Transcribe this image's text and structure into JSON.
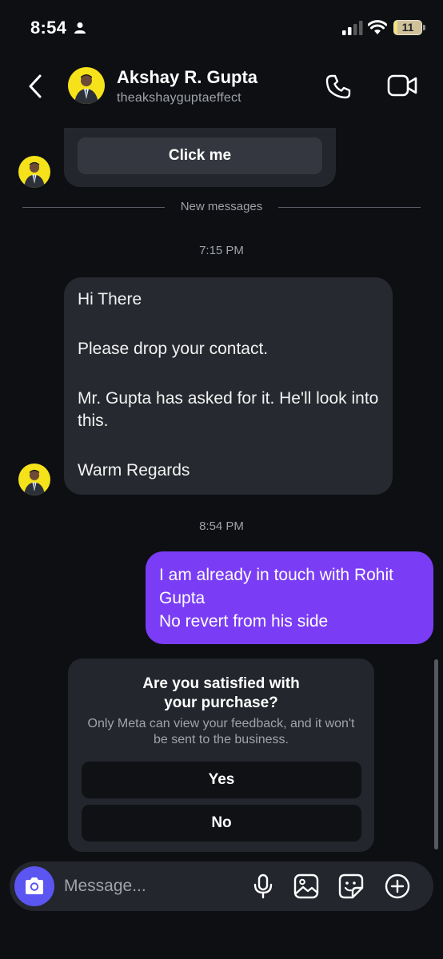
{
  "status": {
    "time": "8:54",
    "battery": "11",
    "battery_level": 0.11
  },
  "header": {
    "contact_name": "Akshay R. Gupta",
    "contact_handle": "theakshayguptaeffect"
  },
  "chat": {
    "card_button_label": "Click me",
    "divider_text": "New messages",
    "time_1": "7:15 PM",
    "incoming": {
      "line_1": "Hi There",
      "line_2": "Please drop your contact.",
      "line_3": "Mr. Gupta has asked for it. He'll look into this.",
      "line_4": "Warm Regards"
    },
    "time_2": "8:54 PM",
    "outgoing": {
      "line_1": "I am already in touch with Rohit Gupta",
      "line_2": "No revert from his side"
    },
    "feedback": {
      "title": "Are you satisfied with your purchase?",
      "subtitle": "Only Meta can view your feedback, and it won't be sent to the business.",
      "yes_label": "Yes",
      "no_label": "No"
    }
  },
  "composer": {
    "placeholder": "Message..."
  },
  "colors": {
    "background": "#0d0f13",
    "bubble_incoming": "#26292f",
    "bubble_outgoing": "#7a3df5",
    "camera_button": "#5b55f2",
    "avatar_bg": "#f5e21a"
  },
  "icons": [
    "person-icon",
    "signal-icon",
    "wifi-icon",
    "battery-icon",
    "back-icon",
    "phone-icon",
    "video-icon",
    "camera-icon",
    "microphone-icon",
    "gallery-icon",
    "sticker-icon",
    "plus-icon"
  ]
}
